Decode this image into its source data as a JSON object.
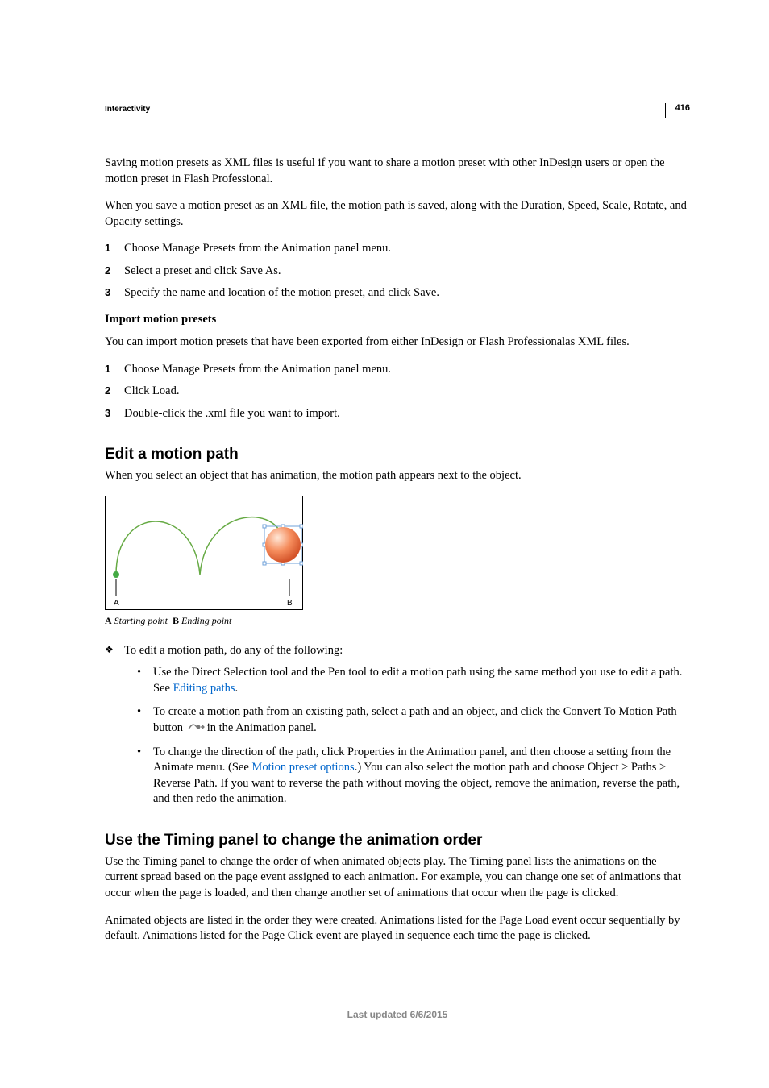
{
  "page_number": "416",
  "section_label": "Interactivity",
  "para1": "Saving motion presets as XML files is useful if you want to share a motion preset with other InDesign users or open the motion preset in Flash Professional.",
  "para2": "When you save a motion preset as an XML file, the motion path is saved, along with the Duration, Speed, Scale, Rotate, and Opacity settings.",
  "list1": [
    "Choose Manage Presets from the Animation panel menu.",
    "Select a preset and click Save As.",
    "Specify the name and location of the motion preset, and click Save."
  ],
  "sub1": "Import motion presets",
  "para3": "You can import motion presets that have been exported from either InDesign or Flash Professionalas XML files.",
  "list2": [
    "Choose Manage Presets from the Animation panel menu.",
    "Click Load.",
    "Double-click the .xml file you want to import."
  ],
  "h2_1": "Edit a motion path",
  "para4": "When you select an object that has animation, the motion path appears next to the object.",
  "caption": {
    "a_label": "A",
    "a_text": "Starting point",
    "b_label": "B",
    "b_text": "Ending point"
  },
  "diamond_text": "To edit a motion path, do any of the following:",
  "bullets": {
    "b1_pre": "Use the Direct Selection tool and the Pen tool to edit a motion path using the same method you use to edit a path. See ",
    "b1_link": "Editing paths",
    "b1_post": ".",
    "b2_pre": "To create a motion path from an existing path, select a path and an object, and click the Convert To Motion Path button ",
    "b2_post": "in the Animation panel.",
    "b3_pre": "To change the direction of the path, click Properties in the Animation panel, and then choose a setting from the Animate menu. (See ",
    "b3_link": "Motion preset options",
    "b3_post": ".) You can also select the motion path and choose Object > Paths > Reverse Path. If you want to reverse the path without moving the object, remove the animation, reverse the path, and then redo the animation."
  },
  "h2_2": "Use the Timing panel to change the animation order",
  "para5": "Use the Timing panel to change the order of when animated objects play. The Timing panel lists the animations on the current spread based on the page event assigned to each animation. For example, you can change one set of animations that occur when the page is loaded, and then change another set of animations that occur when the page is clicked.",
  "para6": "Animated objects are listed in the order they were created. Animations listed for the Page Load event occur sequentially by default. Animations listed for the Page Click event are played in sequence each time the page is clicked.",
  "footer": "Last updated 6/6/2015"
}
